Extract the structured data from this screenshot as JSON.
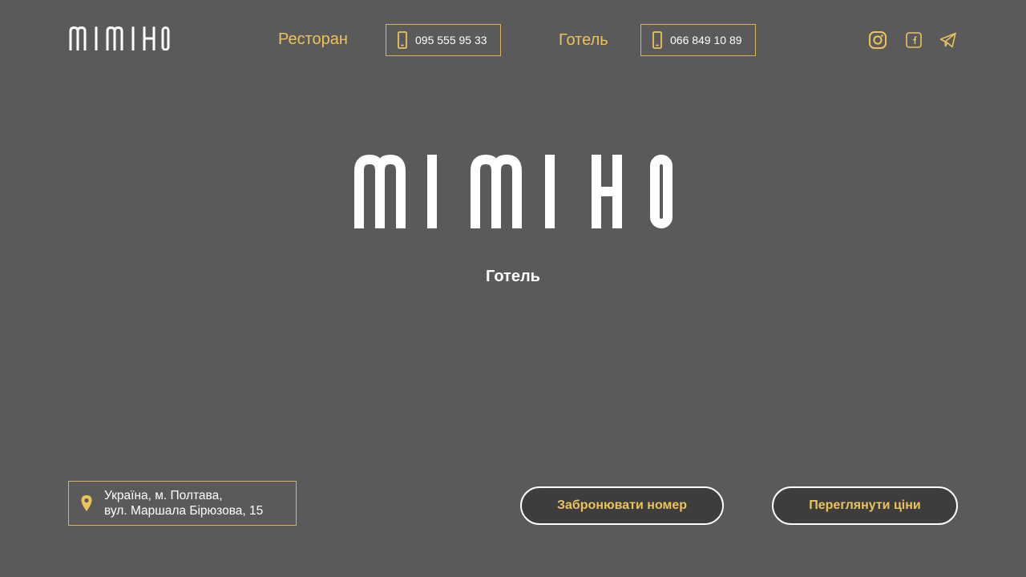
{
  "header": {
    "logo_text": "MIMIHO",
    "restaurant_label": "Ресторан",
    "restaurant_phone": "095 555 95 33",
    "hotel_label": "Готель",
    "hotel_phone": "066 849 10 89",
    "social": [
      {
        "icon": "instagram-icon"
      },
      {
        "icon": "facebook-icon"
      },
      {
        "icon": "telegram-icon"
      }
    ]
  },
  "hero": {
    "logo_text": "MIMIHO",
    "subtitle": "Готель"
  },
  "footer": {
    "address_line1": "Україна, м. Полтава,",
    "address_line2": "вул. Маршала Бірюзова, 15",
    "book_button": "Забронювати номер",
    "prices_button": "Переглянути ціни"
  },
  "colors": {
    "background": "#5a5a5a",
    "accent": "#ecc35a",
    "button_bg": "#3d3d3d",
    "text": "#ffffff"
  }
}
